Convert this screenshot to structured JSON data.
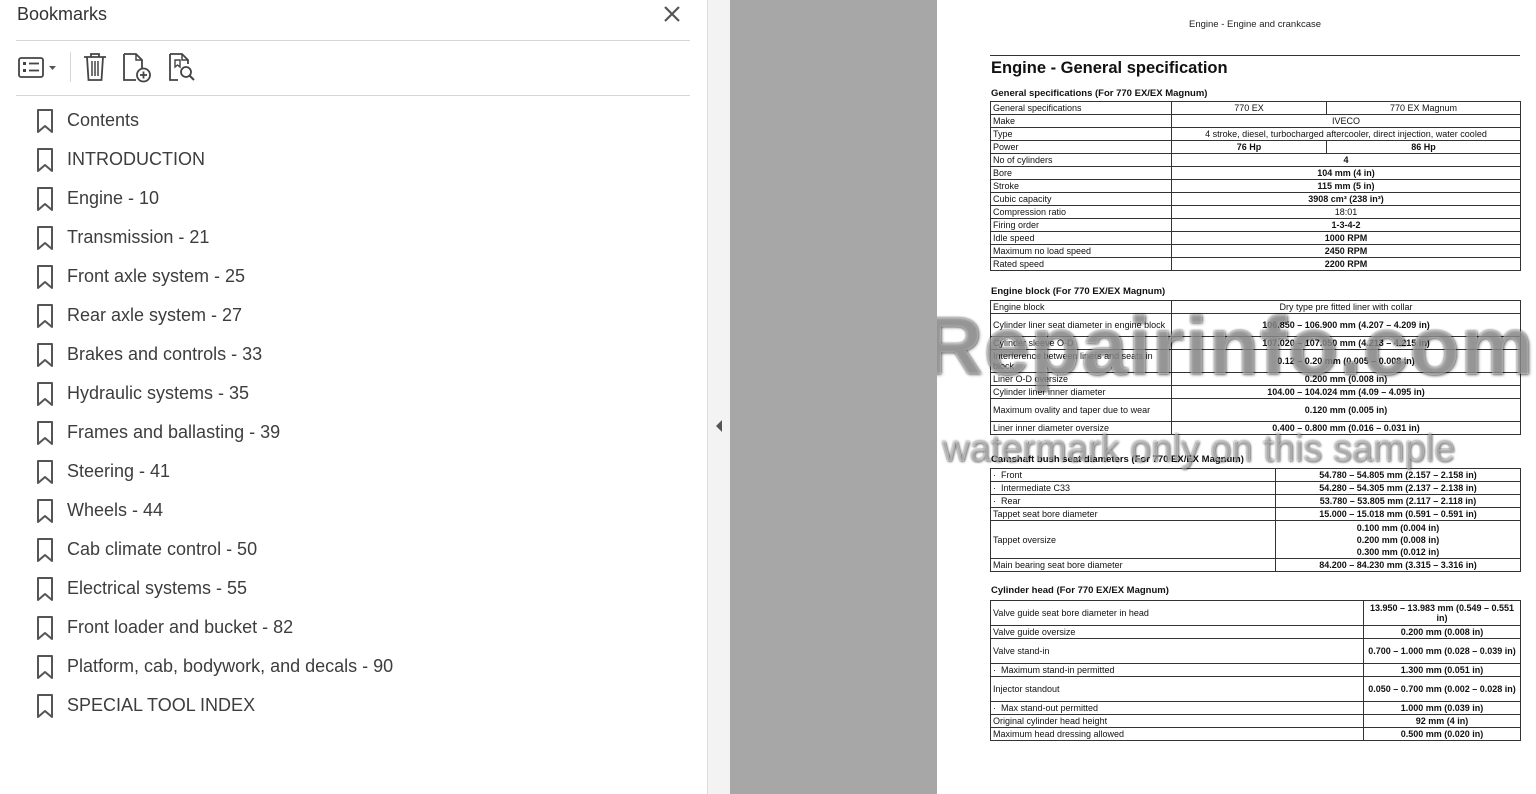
{
  "bookmarks_panel": {
    "title": "Bookmarks",
    "toolbar": {
      "options_icon": "list-options-icon",
      "delete_icon": "trash-icon",
      "new_bookmark_icon": "new-bookmark-icon",
      "find_bookmark_icon": "find-bookmark-icon"
    },
    "items": [
      {
        "label": "Contents"
      },
      {
        "label": "INTRODUCTION"
      },
      {
        "label": "Engine - 10"
      },
      {
        "label": "Transmission - 21"
      },
      {
        "label": "Front axle system - 25"
      },
      {
        "label": "Rear axle system - 27"
      },
      {
        "label": "Brakes and controls - 33"
      },
      {
        "label": "Hydraulic systems - 35"
      },
      {
        "label": "Frames and ballasting - 39"
      },
      {
        "label": "Steering - 41"
      },
      {
        "label": "Wheels - 44"
      },
      {
        "label": "Cab climate control - 50"
      },
      {
        "label": "Electrical systems - 55"
      },
      {
        "label": "Front loader and bucket - 82"
      },
      {
        "label": "Platform, cab, bodywork, and decals - 90"
      },
      {
        "label": "SPECIAL TOOL INDEX"
      }
    ]
  },
  "document": {
    "header": "Engine - Engine and crankcase",
    "title": "Engine - General specification",
    "general": {
      "section_title": "General specifications (For 770 EX/EX Magnum)",
      "col_headers": [
        "General specifications",
        "770 EX",
        "770 EX Magnum"
      ],
      "rows": [
        {
          "label": "Make",
          "value": "IVECO"
        },
        {
          "label": "Type",
          "value": "4 stroke, diesel, turbocharged aftercooler, direct injection, water cooled"
        },
        {
          "label": "Power",
          "value_ex": "76 Hp",
          "value_mag": "86 Hp"
        },
        {
          "label": "No of cylinders",
          "value": "4"
        },
        {
          "label": "Bore",
          "value": "104 mm (4 in)"
        },
        {
          "label": "Stroke",
          "value": "115 mm (5 in)"
        },
        {
          "label": "Cubic capacity",
          "value": "3908 cm³ (238 in³)"
        },
        {
          "label": "Compression ratio",
          "value": "18:01"
        },
        {
          "label": "Firing order",
          "value": "1-3-4-2"
        },
        {
          "label": "Idle speed",
          "value": "1000 RPM"
        },
        {
          "label": "Maximum no load speed",
          "value": "2450 RPM"
        },
        {
          "label": "Rated speed",
          "value": "2200 RPM"
        }
      ]
    },
    "block": {
      "section_title": "Engine block (For 770 EX/EX Magnum)",
      "rows": [
        {
          "label": "Engine block",
          "value": "Dry type pre fitted liner with collar"
        },
        {
          "label": "Cylinder liner seat diameter in engine block",
          "value": "106.850 – 106.900 mm (4.207 – 4.209 in)"
        },
        {
          "label": "Cylinder sleeve O-D",
          "value": "107.020 – 107.050 mm (4.213 – 4.215 in)"
        },
        {
          "label": "Interference between liners and seats in block",
          "value": "0.12 – 0.20 mm (0.005 – 0.008 in)"
        },
        {
          "label": "Liner O-D oversize",
          "value": "0.200 mm (0.008 in)"
        },
        {
          "label": "Cylinder liner inner diameter",
          "value": "104.00 – 104.024 mm (4.09 – 4.095 in)"
        },
        {
          "label": "Maximum ovality and taper due to wear",
          "value": "0.120 mm (0.005 in)"
        },
        {
          "label": "Liner inner diameter oversize",
          "value": "0.400 – 0.800 mm (0.016 – 0.031 in)"
        }
      ]
    },
    "camshaft": {
      "section_title": "Camshaft bush seat diameters (For 770 EX/EX Magnum)",
      "rows": [
        {
          "label": "Front",
          "value": "54.780 – 54.805 mm (2.157 – 2.158 in)"
        },
        {
          "label": "Intermediate C33",
          "value": "54.280 – 54.305 mm (2.137 – 2.138 in)"
        },
        {
          "label": "Rear",
          "value": "53.780 – 53.805 mm (2.117 – 2.118 in)"
        },
        {
          "label": "Tappet seat bore diameter",
          "value": "15.000 – 15.018 mm (0.591 – 0.591 in)"
        }
      ],
      "tappet_oversize": {
        "label": "Tappet oversize",
        "values": [
          "0.100 mm (0.004 in)",
          "0.200 mm (0.008 in)",
          "0.300 mm (0.012 in)"
        ]
      },
      "main_bearing": {
        "label": "Main bearing seat bore diameter",
        "value": "84.200 – 84.230 mm (3.315 – 3.316 in)"
      }
    },
    "head": {
      "section_title": "Cylinder head (For 770 EX/EX Magnum)",
      "rows": [
        {
          "label": "Valve guide seat bore diameter in head",
          "value": "13.950 – 13.983 mm (0.549 – 0.551 in)"
        },
        {
          "label": "Valve guide oversize",
          "value": "0.200 mm (0.008 in)"
        },
        {
          "label": "Valve stand-in",
          "value": "0.700 – 1.000 mm (0.028 – 0.039 in)"
        },
        {
          "label": "Maximum stand-in permitted",
          "value": "1.300 mm (0.051 in)"
        },
        {
          "label": "Injector standout",
          "value": "0.050 – 0.700 mm (0.002 – 0.028 in)"
        },
        {
          "label": "Max stand-out permitted",
          "value": "1.000 mm (0.039 in)"
        },
        {
          "label": "Original cylinder head height",
          "value": "92 mm (4 in)"
        },
        {
          "label": "Maximum head dressing allowed",
          "value": "0.500 mm (0.020 in)"
        }
      ]
    },
    "watermark_line1": "eRepairinfo.com",
    "watermark_line2": "watermark only on this sample"
  }
}
